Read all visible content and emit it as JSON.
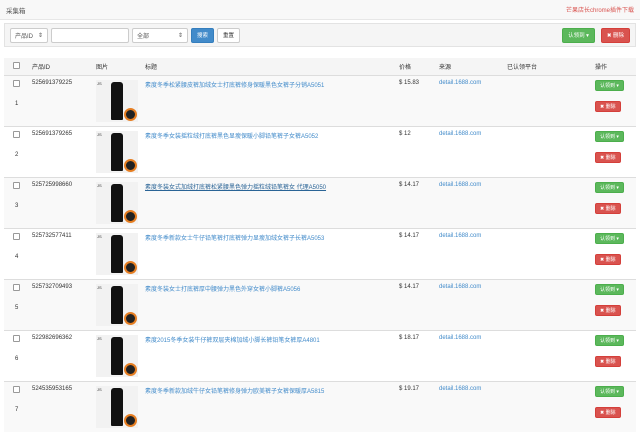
{
  "header": {
    "title": "采集箱",
    "link": "芒果店长chrome插件下载"
  },
  "toolbar": {
    "field_select": "产品ID",
    "search_value": "",
    "status_select": "全部",
    "search": "搜索",
    "reset": "重置",
    "claim": "认领到 ▾",
    "delete": "✖ 删除"
  },
  "table": {
    "headers": [
      "产品ID",
      "图片",
      "标题",
      "价格",
      "来源",
      "已认领平台",
      "操作"
    ],
    "rows": [
      {
        "n": "1",
        "id": "525691379225",
        "title": "素度冬季松紧腰皮裤加绒女士打底裤修身保暖黑色女裤子分销A5051",
        "price": "$ 15.83",
        "source": "detail.1688.com",
        "platform": ""
      },
      {
        "n": "2",
        "id": "525691379265",
        "title": "素度冬季女装摇粒绒打底裤黑色显瘦保暖小脚铅笔裤子女裤A5052",
        "price": "$ 12",
        "source": "detail.1688.com",
        "platform": ""
      },
      {
        "n": "3",
        "id": "525725998660",
        "title": "素度冬装女式加绒打底裤松紧腰黑色弹力摇粒绒铅笔裤女 代理A5050",
        "price": "$ 14.17",
        "source": "detail.1688.com",
        "platform": ""
      },
      {
        "n": "4",
        "id": "525732577411",
        "title": "素度冬季新款女士牛仔铅笔裤打底裤弹力显瘦加绒女裤子长裤A5053",
        "price": "$ 14.17",
        "source": "detail.1688.com",
        "platform": ""
      },
      {
        "n": "5",
        "id": "525732709493",
        "title": "素度冬装女士打底裤厚中腰弹力黑色外穿女裤小脚裤A5056",
        "price": "$ 14.17",
        "source": "detail.1688.com",
        "platform": ""
      },
      {
        "n": "6",
        "id": "522982696362",
        "title": "素度2015冬季女装牛仔裤双层夹棉加绒小脚长裤铅笔女裤厚A4801",
        "price": "$ 18.17",
        "source": "detail.1688.com",
        "platform": ""
      },
      {
        "n": "7",
        "id": "524535953165",
        "title": "素度冬季新款加绒牛仔女铅笔裤修身弹力欧美裤子女裤保暖厚A5815",
        "price": "$ 19.17",
        "source": "detail.1688.com",
        "platform": ""
      }
    ],
    "claim": "认领到 ▾",
    "delete": "✖ 删除",
    "img_label": "JS"
  }
}
